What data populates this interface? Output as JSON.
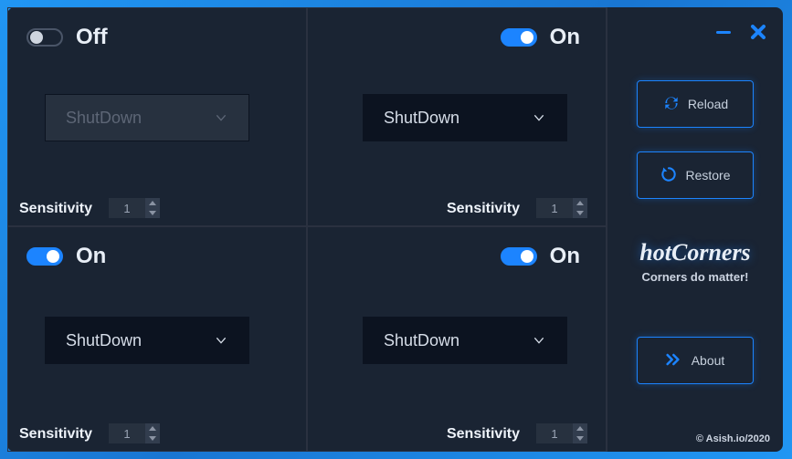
{
  "corners": {
    "top_left": {
      "on": false,
      "state_label": "Off",
      "action": "ShutDown",
      "sens_label": "Sensitivity",
      "sens_value": "1"
    },
    "top_right": {
      "on": true,
      "state_label": "On",
      "action": "ShutDown",
      "sens_label": "Sensitivity",
      "sens_value": "1"
    },
    "bot_left": {
      "on": true,
      "state_label": "On",
      "action": "ShutDown",
      "sens_label": "Sensitivity",
      "sens_value": "1"
    },
    "bot_right": {
      "on": true,
      "state_label": "On",
      "action": "ShutDown",
      "sens_label": "Sensitivity",
      "sens_value": "1"
    }
  },
  "side": {
    "reload": "Reload",
    "restore": "Restore",
    "about": "About",
    "title": "hotCorners",
    "subtitle": "Corners do matter!",
    "copyright": "© Asish.io/2020"
  },
  "colors": {
    "accent": "#1c84ff"
  }
}
